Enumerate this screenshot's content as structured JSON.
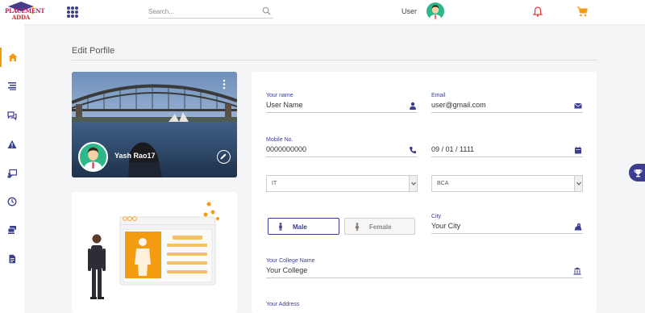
{
  "header": {
    "logo_text_line1": "PLACEMENT",
    "logo_text_line2": "ADDA",
    "search_placeholder": "Search...",
    "user_label": "User"
  },
  "sidebar": {
    "items": [
      {
        "icon": "home-icon",
        "active": true
      },
      {
        "icon": "list-icon",
        "active": false
      },
      {
        "icon": "chat-icon",
        "active": false
      },
      {
        "icon": "warning-icon",
        "active": false
      },
      {
        "icon": "chalkboard-icon",
        "active": false
      },
      {
        "icon": "clock-icon",
        "active": false
      },
      {
        "icon": "layers-icon",
        "active": false
      },
      {
        "icon": "document-icon",
        "active": false
      }
    ]
  },
  "page": {
    "title": "Edit Porfile"
  },
  "profile": {
    "name": "Yash Rao17"
  },
  "form": {
    "name_label": "Your name",
    "name_value": "User Name",
    "email_label": "Email",
    "email_value": "user@gmail.com",
    "mobile_label": "Mobile No.",
    "mobile_value": "0000000000",
    "date_value": "09 / 01 / 1111",
    "branch_value": "IT",
    "course_value": "BCA",
    "gender_male": "Male",
    "gender_female": "Female",
    "city_label": "City",
    "city_value": "Your City",
    "college_label": "Your College Name",
    "college_value": "Your College",
    "address_label": "Your Address"
  },
  "colors": {
    "accent": "#3b3e8f",
    "orange": "#f39c12",
    "bell": "#e53935",
    "avatar_bg": "#2eb88a"
  }
}
